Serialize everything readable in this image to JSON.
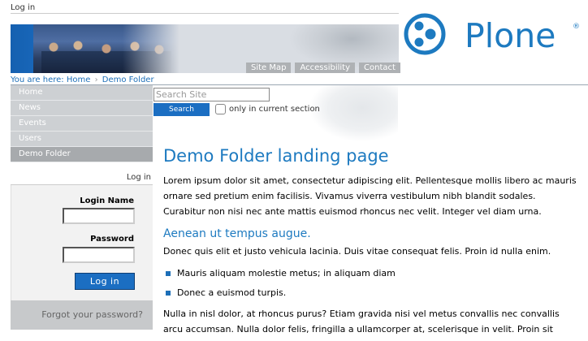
{
  "top": {
    "login_link": "Log in"
  },
  "site_actions": [
    {
      "label": "Site Map"
    },
    {
      "label": "Accessibility"
    },
    {
      "label": "Contact"
    }
  ],
  "logo": {
    "text": "Plone",
    "reg": "®",
    "color": "#1d7ac0"
  },
  "breadcrumb": {
    "prefix": "You are here:",
    "home": "Home",
    "separator": "›",
    "current": "Demo Folder"
  },
  "search": {
    "placeholder": "Search Site",
    "button_label": "Search",
    "checkbox_label": "only in current section"
  },
  "navigation": [
    {
      "label": "Home",
      "active": false
    },
    {
      "label": "News",
      "active": false
    },
    {
      "label": "Events",
      "active": false
    },
    {
      "label": "Users",
      "active": false
    },
    {
      "label": "Demo Folder",
      "active": true
    }
  ],
  "login_portlet": {
    "title": "Log in",
    "login_name_label": "Login Name",
    "password_label": "Password",
    "button_label": "Log in",
    "forgot_label": "Forgot your password?"
  },
  "content": {
    "title": "Demo Folder landing page",
    "intro": "Lorem ipsum dolor sit amet, consectetur adipiscing elit. Pellentesque mollis libero ac mauris ornare sed pretium enim facilisis. Vivamus viverra vestibulum nibh blandit sodales. Curabitur non nisi nec ante mattis euismod rhoncus nec velit. Integer vel diam urna.",
    "subheading": "Aenean ut tempus augue.",
    "para2": "Donec quis elit et justo vehicula lacinia. Duis vitae consequat felis. Proin id nulla enim.",
    "bullets": [
      "Mauris aliquam molestie metus; in aliquam diam",
      "Donec a euismod turpis."
    ],
    "para3": "Nulla in nisl dolor, at rhoncus purus? Etiam gravida nisi vel metus convallis nec convallis arcu accumsan. Nulla dolor felis, fringilla a ullamcorper at, scelerisque in velit. Proin sit amet"
  },
  "colors": {
    "accent": "#1d7ac0",
    "button": "#1b6ec2",
    "nav_bg": "#cdd0d3",
    "nav_active": "#a7aaad"
  }
}
